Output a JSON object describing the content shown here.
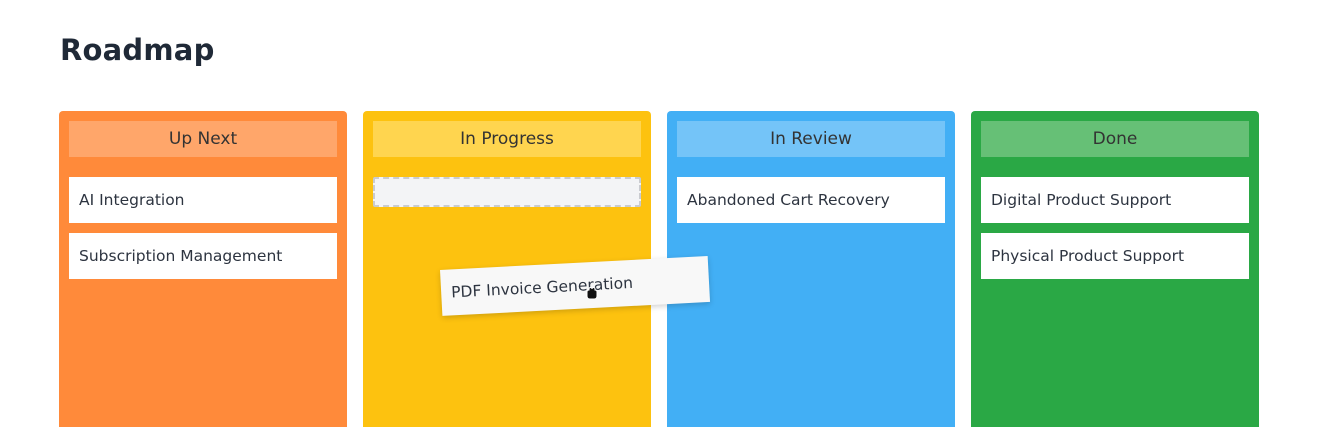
{
  "page": {
    "title": "Roadmap"
  },
  "columns": [
    {
      "name": "Up Next",
      "color": "#ff8a3a",
      "header_color": "#ffa66a",
      "cards": [
        "AI Integration",
        "Subscription Management"
      ]
    },
    {
      "name": "In Progress",
      "color": "#fdc20f",
      "header_color": "#ffd54f",
      "cards": []
    },
    {
      "name": "In Review",
      "color": "#42aff5",
      "header_color": "#74c4f8",
      "cards": [
        "Abandoned Cart Recovery"
      ]
    },
    {
      "name": "Done",
      "color": "#2aa845",
      "header_color": "#66c076",
      "cards": [
        "Digital Product Support",
        "Physical Product Support"
      ]
    }
  ],
  "drag": {
    "card_label": "PDF Invoice Generation",
    "cursor_icon": "grab-hand-icon"
  }
}
